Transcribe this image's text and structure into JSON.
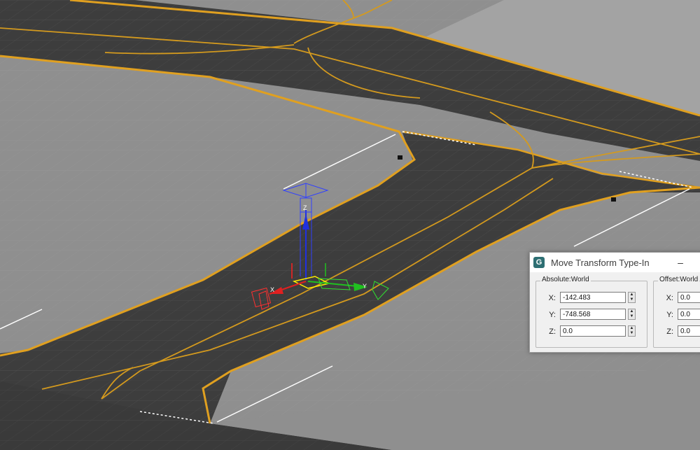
{
  "viewport": {
    "gizmo": {
      "axis_x": "X",
      "axis_y": "Y",
      "axis_z": "Z",
      "color_x": "#e02020",
      "color_y": "#20c020",
      "color_z": "#2030e0",
      "plane_highlight": "#ffee00"
    },
    "colors": {
      "ground": "#8f8f8f",
      "asphalt": "#3d3d3d",
      "edge_line": "#e0a020",
      "grid": "#9c9c9c"
    }
  },
  "dialog": {
    "title": "Move Transform Type-In",
    "app_icon": "3ds-max-icon",
    "minimize_label": "–",
    "absolute": {
      "label": "Absolute:World",
      "x_label": "X:",
      "x_value": "-142.483",
      "y_label": "Y:",
      "y_value": "-748.568",
      "z_label": "Z:",
      "z_value": "0.0"
    },
    "offset": {
      "label": "Offset:World",
      "x_label": "X:",
      "x_value": "0.0",
      "y_label": "Y:",
      "y_value": "0.0",
      "z_label": "Z:",
      "z_value": "0.0"
    },
    "spinner_up": "▲",
    "spinner_down": "▼"
  }
}
